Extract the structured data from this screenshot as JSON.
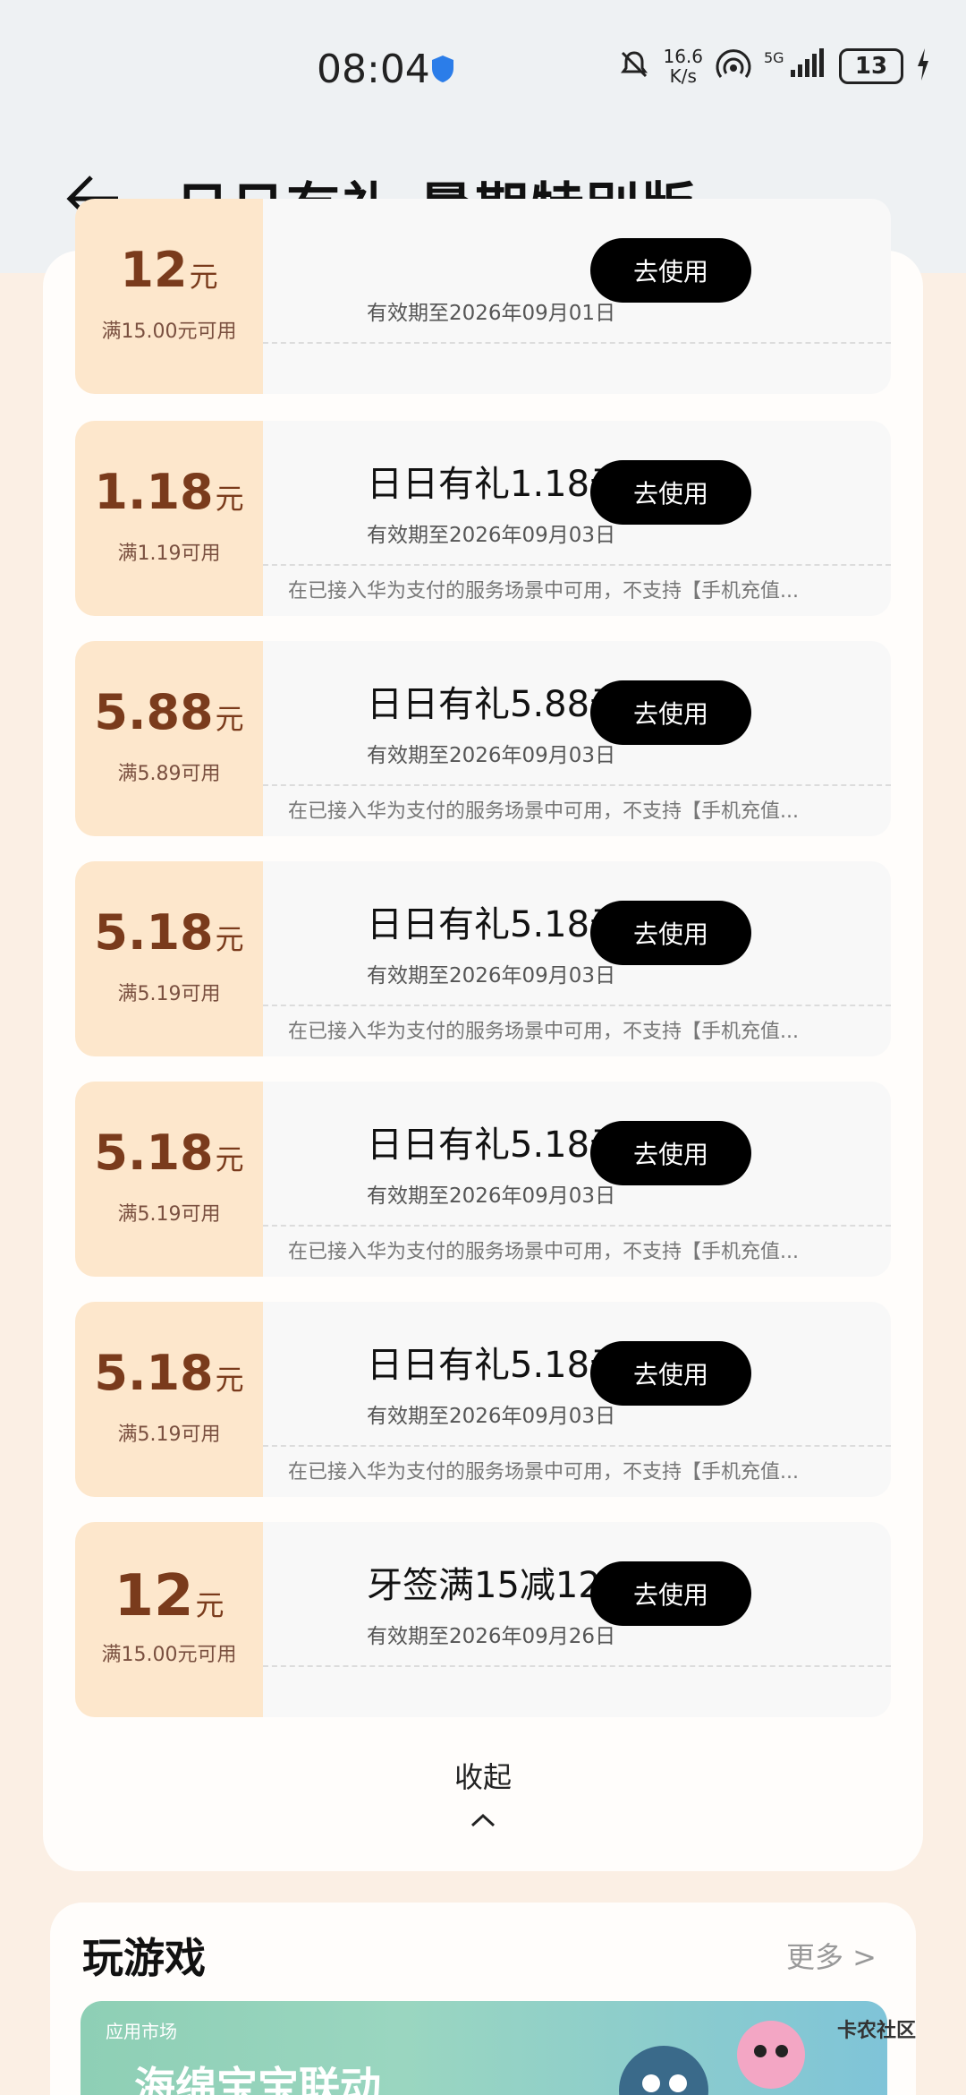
{
  "status": {
    "time": "08:04",
    "speed_top": "16.6",
    "speed_bottom": "K/s",
    "battery": "13"
  },
  "header": {
    "title": "日日有礼·暑期特别版"
  },
  "coupons": [
    {
      "amount": "12",
      "unit": "元",
      "min": "满15.00元可用",
      "name": "",
      "expiry": "有效期至2026年09月01日",
      "desc": "",
      "button": "去使用"
    },
    {
      "amount": "1.18",
      "unit": "元",
      "min": "满1.19可用",
      "name": "日日有礼1.18元券",
      "expiry": "有效期至2026年09月03日",
      "desc": "在已接入华为支付的服务场景中可用，不支持【手机充值...",
      "button": "去使用"
    },
    {
      "amount": "5.88",
      "unit": "元",
      "min": "满5.89可用",
      "name": "日日有礼5.88元券",
      "expiry": "有效期至2026年09月03日",
      "desc": "在已接入华为支付的服务场景中可用，不支持【手机充值...",
      "button": "去使用"
    },
    {
      "amount": "5.18",
      "unit": "元",
      "min": "满5.19可用",
      "name": "日日有礼5.18元券",
      "expiry": "有效期至2026年09月03日",
      "desc": "在已接入华为支付的服务场景中可用，不支持【手机充值...",
      "button": "去使用"
    },
    {
      "amount": "5.18",
      "unit": "元",
      "min": "满5.19可用",
      "name": "日日有礼5.18元券",
      "expiry": "有效期至2026年09月03日",
      "desc": "在已接入华为支付的服务场景中可用，不支持【手机充值...",
      "button": "去使用"
    },
    {
      "amount": "5.18",
      "unit": "元",
      "min": "满5.19可用",
      "name": "日日有礼5.18元券",
      "expiry": "有效期至2026年09月03日",
      "desc": "在已接入华为支付的服务场景中可用，不支持【手机充值...",
      "button": "去使用"
    },
    {
      "amount": "12",
      "unit": "元",
      "min": "满15.00元可用",
      "name": "牙签满15减12元",
      "expiry": "有效期至2026年09月26日",
      "desc": "",
      "button": "去使用"
    }
  ],
  "collapse_label": "收起",
  "games": {
    "title": "玩游戏",
    "more": "更多 >",
    "banner_tag": "应用市场",
    "banner_text": "海绵宝宝联动"
  },
  "watermark": "卡农社区",
  "colors": {
    "coupon_left_bg": "#fde7cc",
    "amount_text": "#7a3b1c",
    "button_bg": "#000000"
  }
}
